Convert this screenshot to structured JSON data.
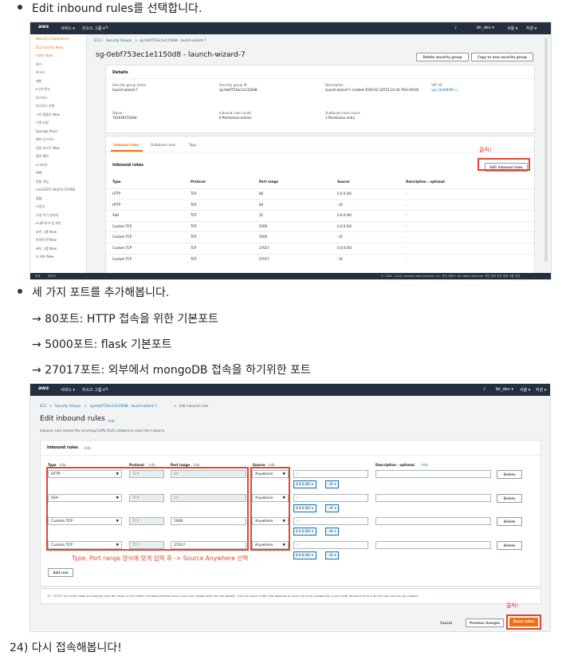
{
  "doc": {
    "bullet1": "Edit inbound rules를 선택합니다.",
    "bullet2": "세 가지 포트를 추가해봅니다.",
    "ports": [
      "→ 80포트: HTTP 접속을 위한 기본포트",
      "→ 5000포트: flask 기본포트",
      "→ 27017포트: 외부에서 mongoDB 접속을 하기위한 포트"
    ],
    "step24": "24) 다시 접속해봅니다!"
  },
  "nav": {
    "aws": "aws",
    "services": "서비스 ▾",
    "resource_groups": "리소스 그룹 ▾",
    "pin": "✎",
    "bell": "♪",
    "user": "bk_dev ▾",
    "region": "서울 ▾",
    "support": "지원 ▾"
  },
  "screen1": {
    "sidebar": [
      "New EC2 Experience",
      "EC2 대시보드 New",
      "이벤트 New",
      "태그",
      "보고서",
      "제한",
      "▾ 인스턴스",
      "인스턴스",
      "인스턴스 유형",
      "시작 템플릿 New",
      "스팟 요청",
      "Savings Plans",
      "예약 인스턴스",
      "전용 호스트 New",
      "용량 예약",
      "▾ 이미지",
      "AMI",
      "번들 작업",
      "▾ ELASTIC BLOCK STORE",
      "볼륨",
      "스냅샷",
      "수명 주기 관리자",
      "▾ 네트워크 및 보안",
      "보안 그룹 New",
      "탄력적 IP New",
      "배치 그룹 New",
      "키 페어 New"
    ],
    "breadcrumb": [
      "EC2",
      "Security Groups",
      "sg-0ebf753ec1e1150d8 - launch-wizard-7"
    ],
    "title": "sg-0ebf753ec1e1150d8 - launch-wizard-7",
    "btn_delete": "Delete security group",
    "btn_copy": "Copy to new security group",
    "details_title": "Details",
    "details": [
      {
        "label": "Security group name",
        "value": "launch-wizard-7"
      },
      {
        "label": "Security group ID",
        "value": "sg-0ebf753ec1e1150d8"
      },
      {
        "label": "Description",
        "value": "launch-wizard-7 created 2020-02-10T23:14:24.793+09:00"
      },
      {
        "label": "VPC ID",
        "value": "vpc-1b3d9d92 ☐"
      },
      {
        "label": "Owner",
        "value": "761639155404"
      },
      {
        "label": "Inbound rules count",
        "value": "6 Permission entries"
      },
      {
        "label": "Outbound rules count",
        "value": "1 Permission entry"
      }
    ],
    "tabs": [
      "Inbound rules",
      "Outbound rules",
      "Tags"
    ],
    "inbound_title": "Inbound rules",
    "edit_btn": "Edit inbound rules",
    "click_label": "클릭!",
    "columns": [
      "Type",
      "Protocol",
      "Port range",
      "Source",
      "Description - optional"
    ],
    "rows": [
      [
        "HTTP",
        "TCP",
        "80",
        "0.0.0.0/0",
        "-"
      ],
      [
        "HTTP",
        "TCP",
        "80",
        "::/0",
        "-"
      ],
      [
        "SSH",
        "TCP",
        "22",
        "0.0.0.0/0",
        "-"
      ],
      [
        "Custom TCP",
        "TCP",
        "5000",
        "0.0.0.0/0",
        "-"
      ],
      [
        "Custom TCP",
        "TCP",
        "5000",
        "::/0",
        "-"
      ],
      [
        "Custom TCP",
        "TCP",
        "27017",
        "0.0.0.0/0",
        "-"
      ],
      [
        "Custom TCP",
        "TCP",
        "27017",
        "::/0",
        "-"
      ]
    ],
    "footer_left": [
      "의견",
      "한국어"
    ],
    "footer_right": "© 2008 - 2020, Amazon Web Services, Inc. 또는 자회사. All rights reserved.   개인 정보 보호 정책   이용 약관"
  },
  "screen2": {
    "breadcrumb": [
      "EC2",
      "Security Groups",
      "sg-0ebf753ec1e1150d8 - launch-wizard-7",
      "Edit inbound rules"
    ],
    "title": "Edit inbound rules",
    "info": "Info",
    "subtitle": "Inbound rules control the incoming traffic that's allowed to reach the instance.",
    "panel_title": "Inbound rules",
    "col_type": "Type",
    "col_protocol": "Protocol",
    "col_port": "Port range",
    "col_source": "Source",
    "col_desc": "Description - optional",
    "rules": [
      {
        "type": "HTTP",
        "protocol": "TCP",
        "port": "80",
        "source": "Anywhere"
      },
      {
        "type": "SSH",
        "protocol": "TCP",
        "port": "22",
        "source": "Anywhere"
      },
      {
        "type": "Custom TCP",
        "protocol": "TCP",
        "port": "5000",
        "source": "Anywhere"
      },
      {
        "type": "Custom TCP",
        "protocol": "TCP",
        "port": "27017",
        "source": "Anywhere"
      }
    ],
    "chip_v4": "0.0.0.0/0 ✕",
    "chip_v6": "::/0 ✕",
    "delete_btn": "Delete",
    "add_rule": "Add rule",
    "annotation": "Type, Port range 양식에 맞게 입력 후 -> Source Anywhere 선택",
    "note": "NOTE: Any edits made on existing rules will result in the edited rule being deleted and a new rule created with the new details. This will cause traffic that depends on that rule to be dropped for a very brief period of time until the new rule can be created.",
    "click_label": "클릭!",
    "cancel": "Cancel",
    "preview": "Preview changes",
    "save": "Save rules"
  }
}
